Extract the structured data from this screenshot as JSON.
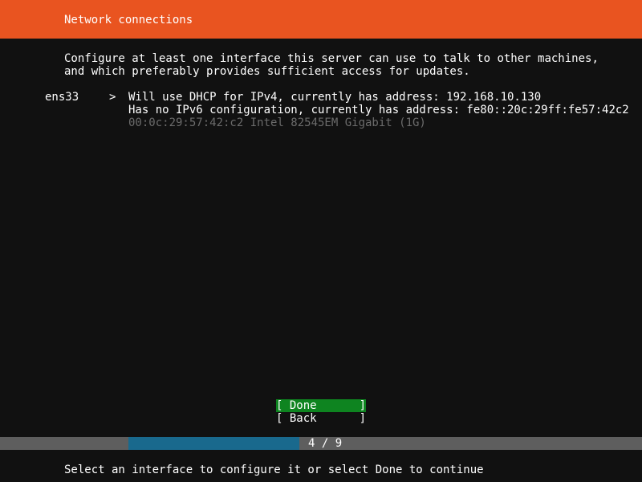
{
  "header": {
    "title": "Network connections"
  },
  "intro": {
    "line1": "Configure at least one interface this server can use to talk to other machines,",
    "line2": "and which preferably provides sufficient access for updates."
  },
  "interfaces": [
    {
      "name": "ens33",
      "chevron": ">",
      "ipv4": "Will use DHCP for IPv4, currently has address: 192.168.10.130",
      "ipv6": "Has no IPv6 configuration, currently has address: fe80::20c:29ff:fe57:42c2",
      "hardware": "00:0c:29:57:42:c2 Intel 82545EM Gigabit (1G)"
    }
  ],
  "buttons": {
    "done": "[ Done",
    "done_close": "]",
    "back": "[ Back",
    "back_close": "]"
  },
  "progress": {
    "label": "4 / 9",
    "fraction": 0.444
  },
  "footer": {
    "hint": "Select an interface to configure it or select Done to continue"
  },
  "colors": {
    "header_bg": "#e95420",
    "selected_button_bg": "#0e8420",
    "progress_fill": "#19698d",
    "progress_track": "#5e5e5e",
    "dim_text": "#6b6b6b"
  }
}
